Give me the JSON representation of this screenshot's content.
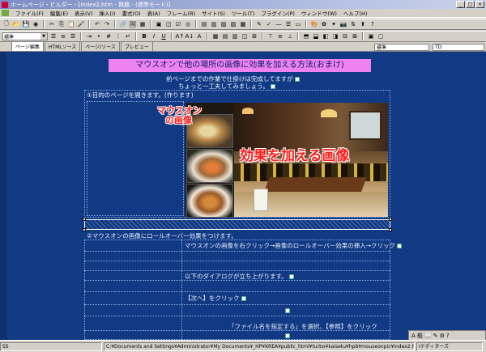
{
  "window": {
    "title": "ホームページ・ビルダー - [index2.htm - 無題 - (標準モード)]",
    "buttons": [
      "_",
      "□",
      "×"
    ]
  },
  "menu": {
    "items": [
      "ファイル(F)",
      "編集(E)",
      "表示(V)",
      "挿入(I)",
      "書式(O)",
      "表(A)",
      "フレーム(R)",
      "サイト(S)",
      "ツール(T)",
      "プラグイン(P)",
      "ウィンドウ(W)",
      "ヘルプ(H)"
    ]
  },
  "toolbar": {
    "style_select": "標準",
    "bold": "B",
    "italic": "I",
    "underline": "U"
  },
  "tabs": {
    "items": [
      "ページ編集",
      "HTMLソース",
      "ページ/ソース",
      "プレビュー"
    ],
    "active": 0,
    "right_select_1": "標準",
    "right_select_2": "TD"
  },
  "content": {
    "heading": "マウスオンで他の場所の画像に効果を加える方法(おまけ)",
    "line1": "前ページまでの作業で仕掛けは完成してますが",
    "line2": "ちょっと一工夫してみましょう。",
    "step1": "①目的のページを開きます。(作ります)",
    "overlay_mouseon_1": "マウスオン",
    "overlay_mouseon_2": "の画像",
    "overlay_effect": "効果を加える画像",
    "step2": "②マウスオンの画像にロールオーバー効果をつけます。",
    "row1": "マウスオンの画像を右クリック→画像のロールオーバー効果の挿入→クリック",
    "row2": "以下のダイアログが立ち上がります。",
    "row3": "【次へ】をクリック",
    "row4": "「ファイル名を指定する」を選択、【参照】をクリック"
  },
  "status": {
    "mode": "SS",
    "path": "C:¥Documents and Settings¥Administrator¥My Documents¥_HP¥KREA¥public_html¥turbo¥kaisetu¥hpb¥mouseonpic¥index2.htm",
    "encoding": "Ⅰテディターズ"
  },
  "ime": {
    "label": "A 般"
  }
}
